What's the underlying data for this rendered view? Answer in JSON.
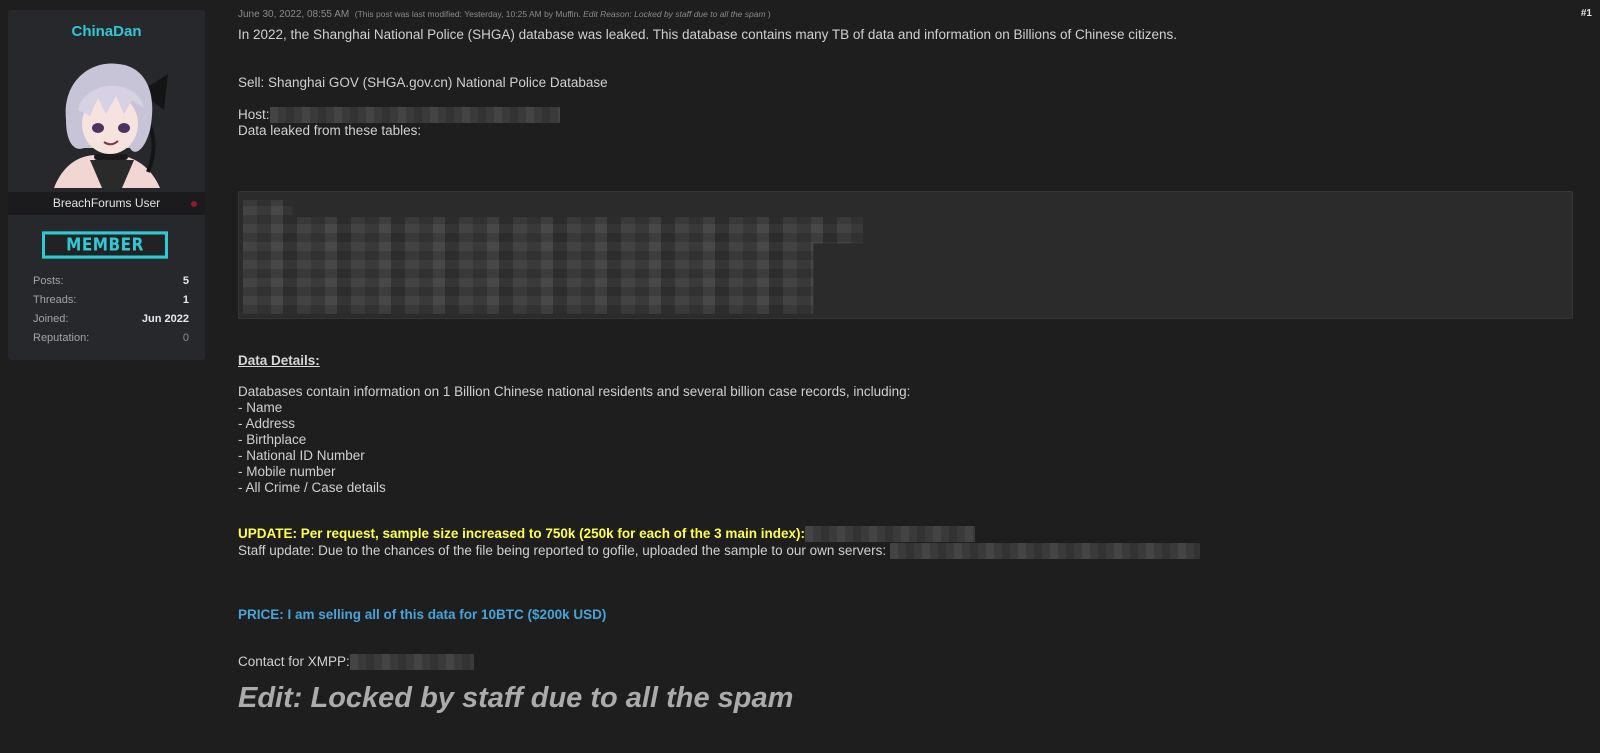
{
  "user": {
    "username": "ChinaDan",
    "title": "BreachForums User",
    "rank": "MEMBER",
    "stats": [
      {
        "label": "Posts:",
        "value": "5"
      },
      {
        "label": "Threads:",
        "value": "1"
      },
      {
        "label": "Joined:",
        "value": "Jun 2022"
      },
      {
        "label": "Reputation:",
        "value": "0"
      }
    ],
    "colors": {
      "accent": "#2ec9d6",
      "status": "#8c1f1f"
    }
  },
  "post": {
    "date": "June 30, 2022, 08:55 AM",
    "modified_prefix": "(This post was last modified: Yesterday, 10:25 AM by Muffin.",
    "edit_reason": "Edit Reason: Locked by staff due to all the spam",
    "modified_suffix": ")",
    "number": "#1",
    "intro": "In 2022, the Shanghai National Police (SHGA) database was leaked. This database contains many TB of data and information on Billions of Chinese citizens.",
    "sell_line": "Sell: Shanghai GOV (SHGA.gov.cn) National Police Database",
    "host_label": "Host:",
    "tables_line": "Data leaked from these tables:",
    "details_heading": "Data Details:",
    "details_intro": "Databases contain information on 1 Billion Chinese national residents and several billion case records, including:",
    "details_items": [
      "- Name",
      "- Address",
      "- Birthplace",
      "- National ID Number",
      "- Mobile number",
      "- All Crime / Case details"
    ],
    "update_line": "UPDATE: Per request, sample size increased to 750k (250k for each of the 3 main index):",
    "staff_update": "Staff update: Due to the chances of the file being reported to gofile, uploaded the sample to our own servers:",
    "price_line": "PRICE: I am selling all of this data for 10BTC ($200k USD)",
    "contact_label": "Contact for XMPP:",
    "edit_note": "Edit: Locked by staff due to all the spam",
    "colors": {
      "update": "#ffff4a",
      "price": "#45a4da"
    }
  }
}
